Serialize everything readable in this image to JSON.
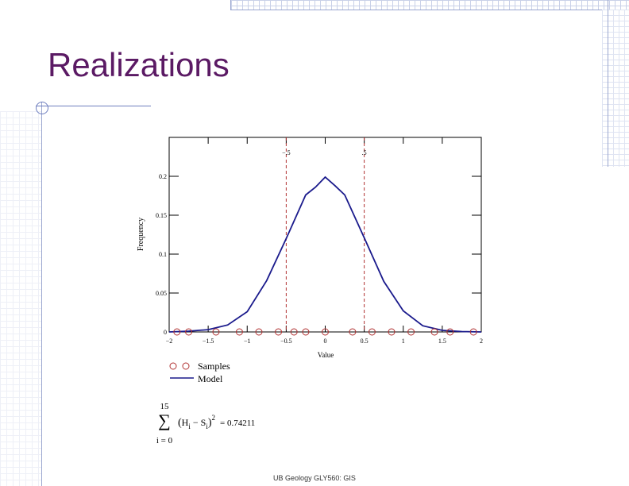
{
  "slide": {
    "title": "Realizations",
    "footer": "UB Geology GLY560: GIS"
  },
  "colors": {
    "title": "#5b1a64",
    "model": "#1a1a8c",
    "samples": "#b03030",
    "vline": "#b03030"
  },
  "chart_data": {
    "type": "line",
    "xlabel": "Value",
    "ylabel": "Frequency",
    "xlim": [
      -2,
      2
    ],
    "ylim": [
      0,
      0.25
    ],
    "xticks": [
      -2,
      -1.5,
      -1,
      -0.5,
      0,
      0.5,
      1,
      1.5,
      2
    ],
    "xtick_labels": [
      "−2",
      "−1.5",
      "−1",
      "−0.5",
      "0",
      "0.5",
      "1",
      "1.5",
      "2"
    ],
    "yticks": [
      0,
      0.05,
      0.1,
      0.15,
      0.2
    ],
    "ytick_labels": [
      "0",
      "0.05",
      "0.1",
      "0.15",
      "0.2"
    ],
    "vlines": [
      {
        "x": -0.5,
        "label": "−.5"
      },
      {
        "x": 0.5,
        "label": ".5"
      }
    ],
    "series": [
      {
        "name": "Model",
        "style": "line",
        "x": [
          -2,
          -1.75,
          -1.5,
          -1.25,
          -1,
          -0.75,
          -0.5,
          -0.25,
          -0.125,
          0,
          0.125,
          0.25,
          0.5,
          0.75,
          1,
          1.25,
          1.5,
          1.75,
          2
        ],
        "y": [
          0.0,
          0.001,
          0.003,
          0.009,
          0.026,
          0.066,
          0.12,
          0.176,
          0.186,
          0.199,
          0.188,
          0.176,
          0.121,
          0.065,
          0.027,
          0.008,
          0.002,
          0.0005,
          0.0
        ]
      },
      {
        "name": "Samples",
        "style": "markers",
        "x": [
          -1.9,
          -1.75,
          -1.4,
          -1.1,
          -0.85,
          -0.6,
          -0.4,
          -0.25,
          0,
          0.35,
          0.6,
          0.85,
          1.1,
          1.4,
          1.6,
          1.9
        ],
        "y": [
          0,
          0,
          0,
          0,
          0,
          0,
          0,
          0,
          0,
          0,
          0,
          0,
          0,
          0,
          0,
          0
        ]
      }
    ],
    "legend": {
      "placement": "bottom-left",
      "entries": [
        "Samples",
        "Model"
      ]
    }
  },
  "formula": {
    "upper": "15",
    "sigma": "∑",
    "lower": "i = 0",
    "expr_open": "(",
    "H": "H",
    "H_sub": "i",
    "minus": " − ",
    "S": "S",
    "S_sub": "i",
    "expr_close": ")",
    "power": "2",
    "result": "= 0.74211"
  }
}
